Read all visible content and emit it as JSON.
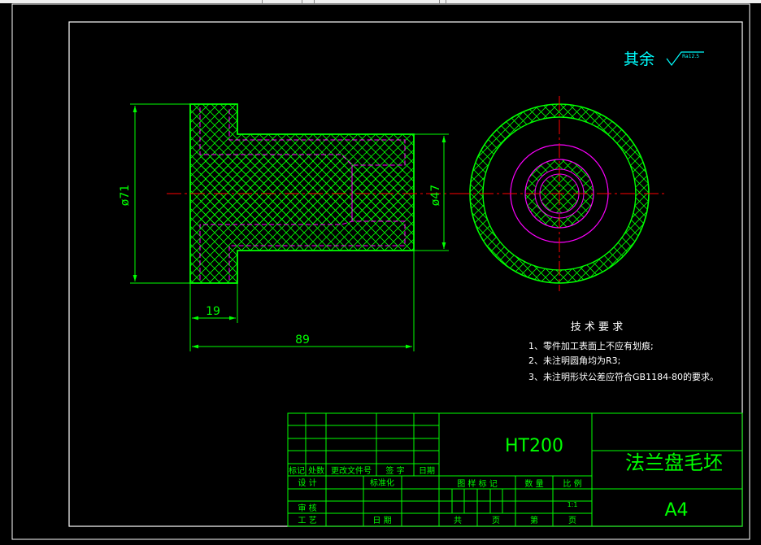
{
  "colors": {
    "background": "#000000",
    "frame": "#ffffff",
    "outline": "#00ff00",
    "hatch": "#00ff00",
    "hidden": "#ff00ff",
    "center": "#ff0000",
    "text": "#00ffff",
    "dimension": "#00ff00",
    "table": "#00ff00"
  },
  "surface_finish": {
    "label": "其余",
    "symbol_value": "Ra12.5"
  },
  "dimensions": {
    "outer_diameter": "ø71",
    "boss_diameter": "ø47",
    "flange_thickness": "19",
    "overall_length": "89"
  },
  "tech_requirements": {
    "title": "技 术 要 求",
    "items": [
      "1、零件加工表面上不应有划痕;",
      "2、未注明圆角均为R3;",
      "3、未注明形状公差应符合GB1184-80的要求。"
    ]
  },
  "title_block": {
    "material": "HT200",
    "part_name": "法兰盘毛坯",
    "sheet_size": "A4",
    "revision_headers": [
      "标记",
      "处数",
      "更改文件号",
      "签 字",
      "日期"
    ],
    "design": "设 计",
    "standardization": "标准化",
    "review": "审 核",
    "process": "工 艺",
    "date": "日 期",
    "stage_mark": "图 样 标 记",
    "quantity": "数 量",
    "scale_label": "比 例",
    "scale_value": "1:1",
    "total_sheets": "共",
    "page_unit": "页",
    "sheet_no": "第",
    "page_unit2": "页"
  }
}
